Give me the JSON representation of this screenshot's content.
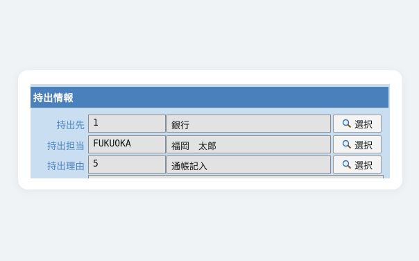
{
  "panel": {
    "title": "持出情報"
  },
  "rows": [
    {
      "label": "持出先",
      "code": "1",
      "name": "銀行",
      "button": "選択"
    },
    {
      "label": "持出担当",
      "code": "FUKUOKA",
      "name": "福岡　太郎",
      "button": "選択"
    },
    {
      "label": "持出理由",
      "code": "5",
      "name": "通帳記入",
      "button": "選択"
    }
  ],
  "colors": {
    "header": "#4a81bc",
    "panel_bg": "#c9def0",
    "label": "#4f86c5",
    "field_bg": "#e2e2e2"
  },
  "icons": {
    "select_button": "search-icon"
  }
}
